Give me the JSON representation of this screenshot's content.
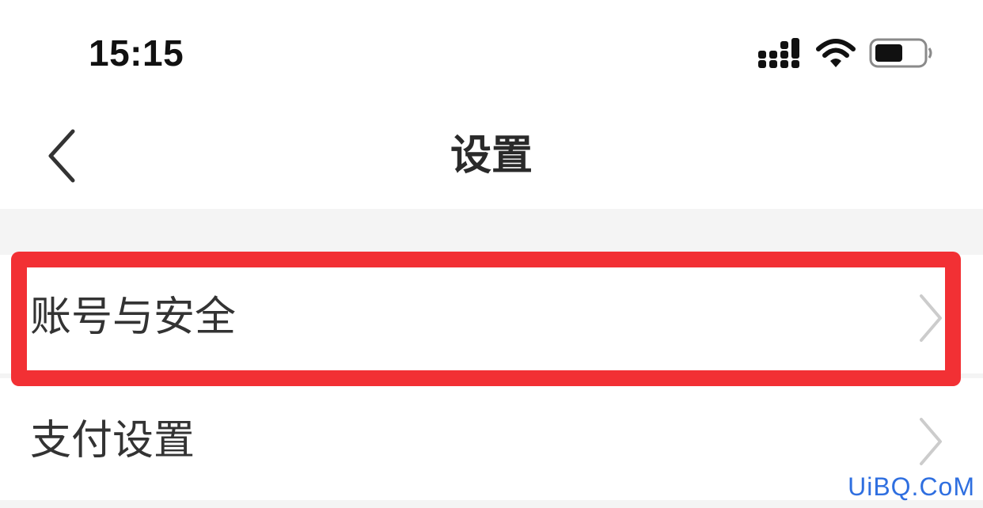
{
  "status_bar": {
    "time": "15:15",
    "icons": [
      "cellular-signal-icon",
      "wifi-icon",
      "battery-icon"
    ]
  },
  "nav": {
    "title": "设置",
    "back_icon": "chevron-left-icon"
  },
  "settings": {
    "items": [
      {
        "label": "账号与安全",
        "icon": "chevron-right-icon",
        "highlighted": true
      },
      {
        "label": "支付设置",
        "icon": "chevron-right-icon",
        "highlighted": false
      }
    ]
  },
  "annotation": {
    "color": "#f23034"
  },
  "watermark": {
    "text": "UiBQ.CoM",
    "color": "#2f6fe0"
  }
}
